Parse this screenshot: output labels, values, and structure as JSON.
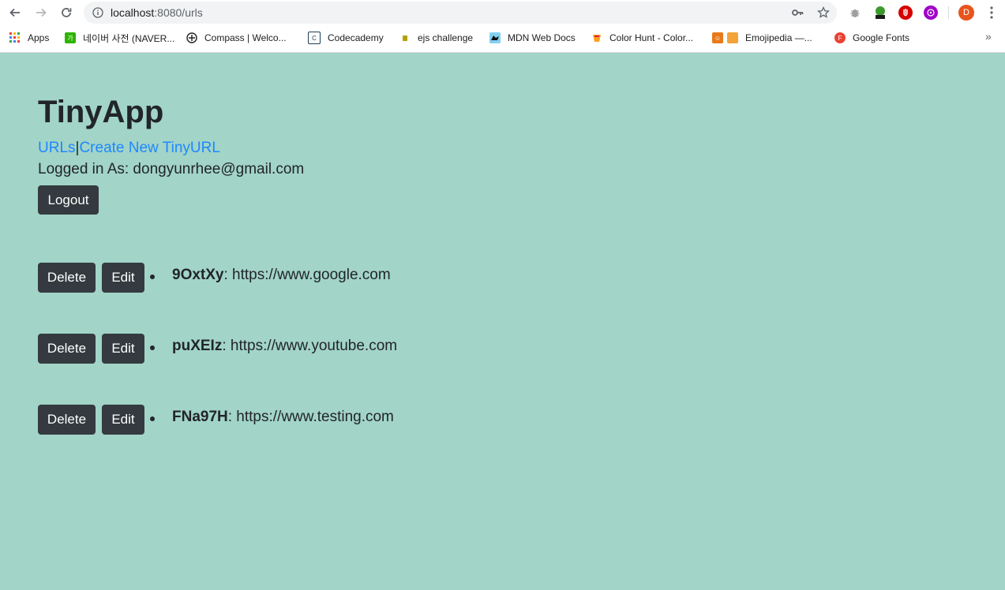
{
  "browser": {
    "url_host": "localhost",
    "url_port_path": ":8080/urls",
    "profile_initial": "D",
    "bookmarks": [
      {
        "label": "Apps",
        "icon": "apps-grid-icon",
        "color": "#4285f4"
      },
      {
        "label": "네이버 사전 (NAVER...",
        "icon": "naver-dictionary-icon",
        "color": "#2db400"
      },
      {
        "label": "Compass | Welco...",
        "icon": "compass-icon",
        "color": "#202124"
      },
      {
        "label": "Codecademy",
        "icon": "codecademy-icon",
        "color": "#1f4056"
      },
      {
        "label": "ejs challenge",
        "icon": "ejs-icon",
        "color": "#b4a000"
      },
      {
        "label": "MDN Web Docs",
        "icon": "mdn-icon",
        "color": "#83d0f2"
      },
      {
        "label": "Color Hunt - Color...",
        "icon": "color-hunt-icon",
        "color": "#ff9f1c"
      },
      {
        "label": "Emojipedia —...",
        "icon": "emojipedia-icon",
        "color": "#e87a1a"
      },
      {
        "label": "Google Fonts",
        "icon": "google-fonts-icon",
        "color": "#ea4335"
      }
    ],
    "more_label": "»"
  },
  "page": {
    "title": "TinyApp",
    "nav": {
      "urls_link": "URLs",
      "separator": "|",
      "create_link": "Create New TinyURL"
    },
    "logged_in_text": "Logged in As: dongyunrhee@gmail.com",
    "logout_label": "Logout",
    "delete_label": "Delete",
    "edit_label": "Edit",
    "urls": [
      {
        "short": "9OxtXy",
        "long": ": https://www.google.com"
      },
      {
        "short": "puXEIz",
        "long": ": https://www.youtube.com"
      },
      {
        "short": "FNa97H",
        "long": ": https://www.testing.com"
      }
    ]
  },
  "colors": {
    "background": "#a2d4c8",
    "button_dark": "#343a40",
    "link": "#1e88ff",
    "text": "#212529"
  }
}
